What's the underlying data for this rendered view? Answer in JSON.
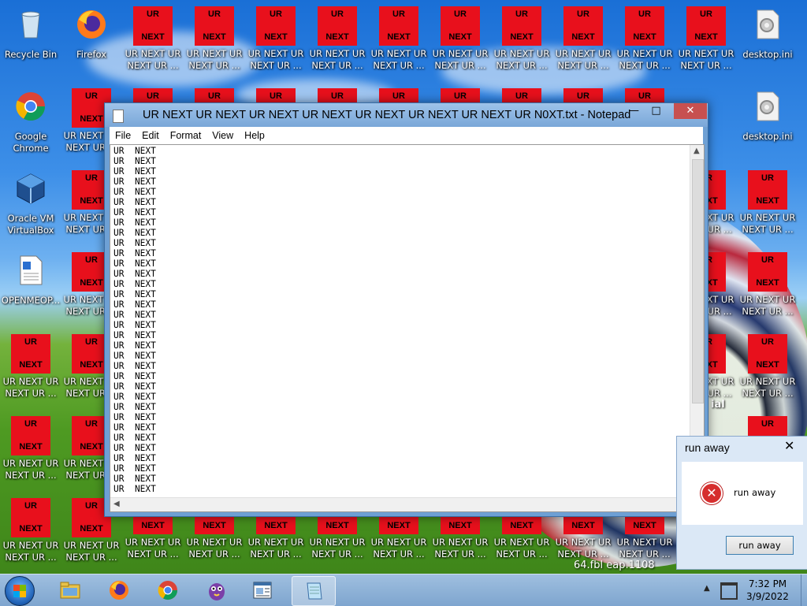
{
  "desktop": {
    "system_icons": [
      {
        "name": "recycle-bin",
        "label": "Recycle Bin"
      },
      {
        "name": "firefox",
        "label": "Firefox"
      },
      {
        "name": "google-chrome",
        "label": "Google\nChrome"
      },
      {
        "name": "virtualbox",
        "label": "Oracle VM\nVirtualBox"
      },
      {
        "name": "openmeop",
        "label": "OPENMEOP..."
      },
      {
        "name": "desktop-ini-1",
        "label": "desktop.ini"
      },
      {
        "name": "desktop-ini-2",
        "label": "desktop.ini"
      }
    ],
    "red_icon": {
      "top_text": "UR",
      "bottom_text": "NEXT",
      "label": "UR NEXT UR\nNEXT UR ...",
      "bottom_row_text": "NEXT"
    },
    "behind_text_1": "ial",
    "behind_text_2": "64.fbl eap.1108"
  },
  "notepad": {
    "title": "UR NEXT UR NEXT UR NEXT UR NEXT UR NEXT UR NEXT UR NEXT UR N0XT.txt - Notepad",
    "menu": [
      "File",
      "Edit",
      "Format",
      "View",
      "Help"
    ],
    "line_text": "UR  NEXT",
    "line_count": 34,
    "minimize": "—",
    "maximize": "□",
    "close": "✕"
  },
  "dialog": {
    "title": "run away",
    "close": "✕",
    "message": "run away",
    "button": "run away"
  },
  "taskbar": {
    "apps": [
      {
        "name": "file-explorer",
        "active": false
      },
      {
        "name": "firefox",
        "active": false
      },
      {
        "name": "chrome",
        "active": false
      },
      {
        "name": "purple-mascot-app",
        "active": false
      },
      {
        "name": "wordpad",
        "active": false
      },
      {
        "name": "notepad",
        "active": true
      }
    ],
    "time": "7:32 PM",
    "date": "3/9/2022",
    "tray_up": "▲"
  },
  "colors": {
    "red_icon": "#e8101c",
    "notepad_frame": "#6ea0d4",
    "close_button": "#c75050"
  }
}
